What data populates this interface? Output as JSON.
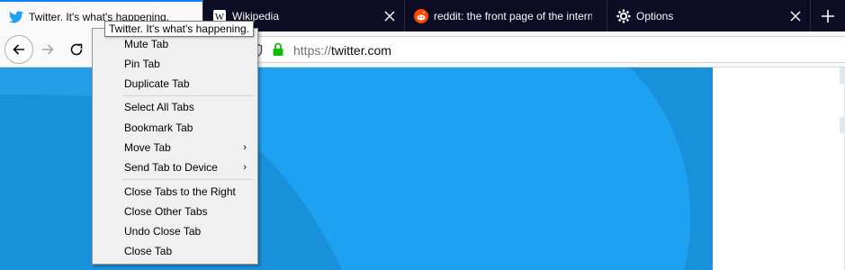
{
  "tabs": [
    {
      "title": "Twitter. It's what's happening.",
      "favicon": "twitter-bird-icon",
      "active": true
    },
    {
      "title": "Wikipedia",
      "favicon": "wikipedia-icon",
      "active": false
    },
    {
      "title": "reddit: the front page of the internet",
      "favicon": "reddit-icon",
      "active": false
    },
    {
      "title": "Options",
      "favicon": "gear-icon",
      "active": false
    }
  ],
  "tooltip": "Twitter. It's what's happening.",
  "url": {
    "scheme": "https://",
    "host": "twitter.com"
  },
  "context_menu": {
    "items": [
      {
        "label": "Mute Tab",
        "submenu": false
      },
      {
        "label": "Pin Tab",
        "submenu": false
      },
      {
        "label": "Duplicate Tab",
        "submenu": false
      },
      {
        "label": "Select All Tabs",
        "submenu": false
      },
      {
        "label": "Bookmark Tab",
        "submenu": false
      },
      {
        "label": "Move Tab",
        "submenu": true
      },
      {
        "label": "Send Tab to Device",
        "submenu": true
      },
      {
        "label": "Close Tabs to the Right",
        "submenu": false
      },
      {
        "label": "Close Other Tabs",
        "submenu": false
      },
      {
        "label": "Undo Close Tab",
        "submenu": false
      },
      {
        "label": "Close Tab",
        "submenu": false
      }
    ]
  },
  "colors": {
    "tabstrip_bg": "#0c0c24",
    "active_tab_accent": "#0a84ff",
    "twitter_blue": "#1da1f2",
    "lock_green": "#12bc00"
  }
}
